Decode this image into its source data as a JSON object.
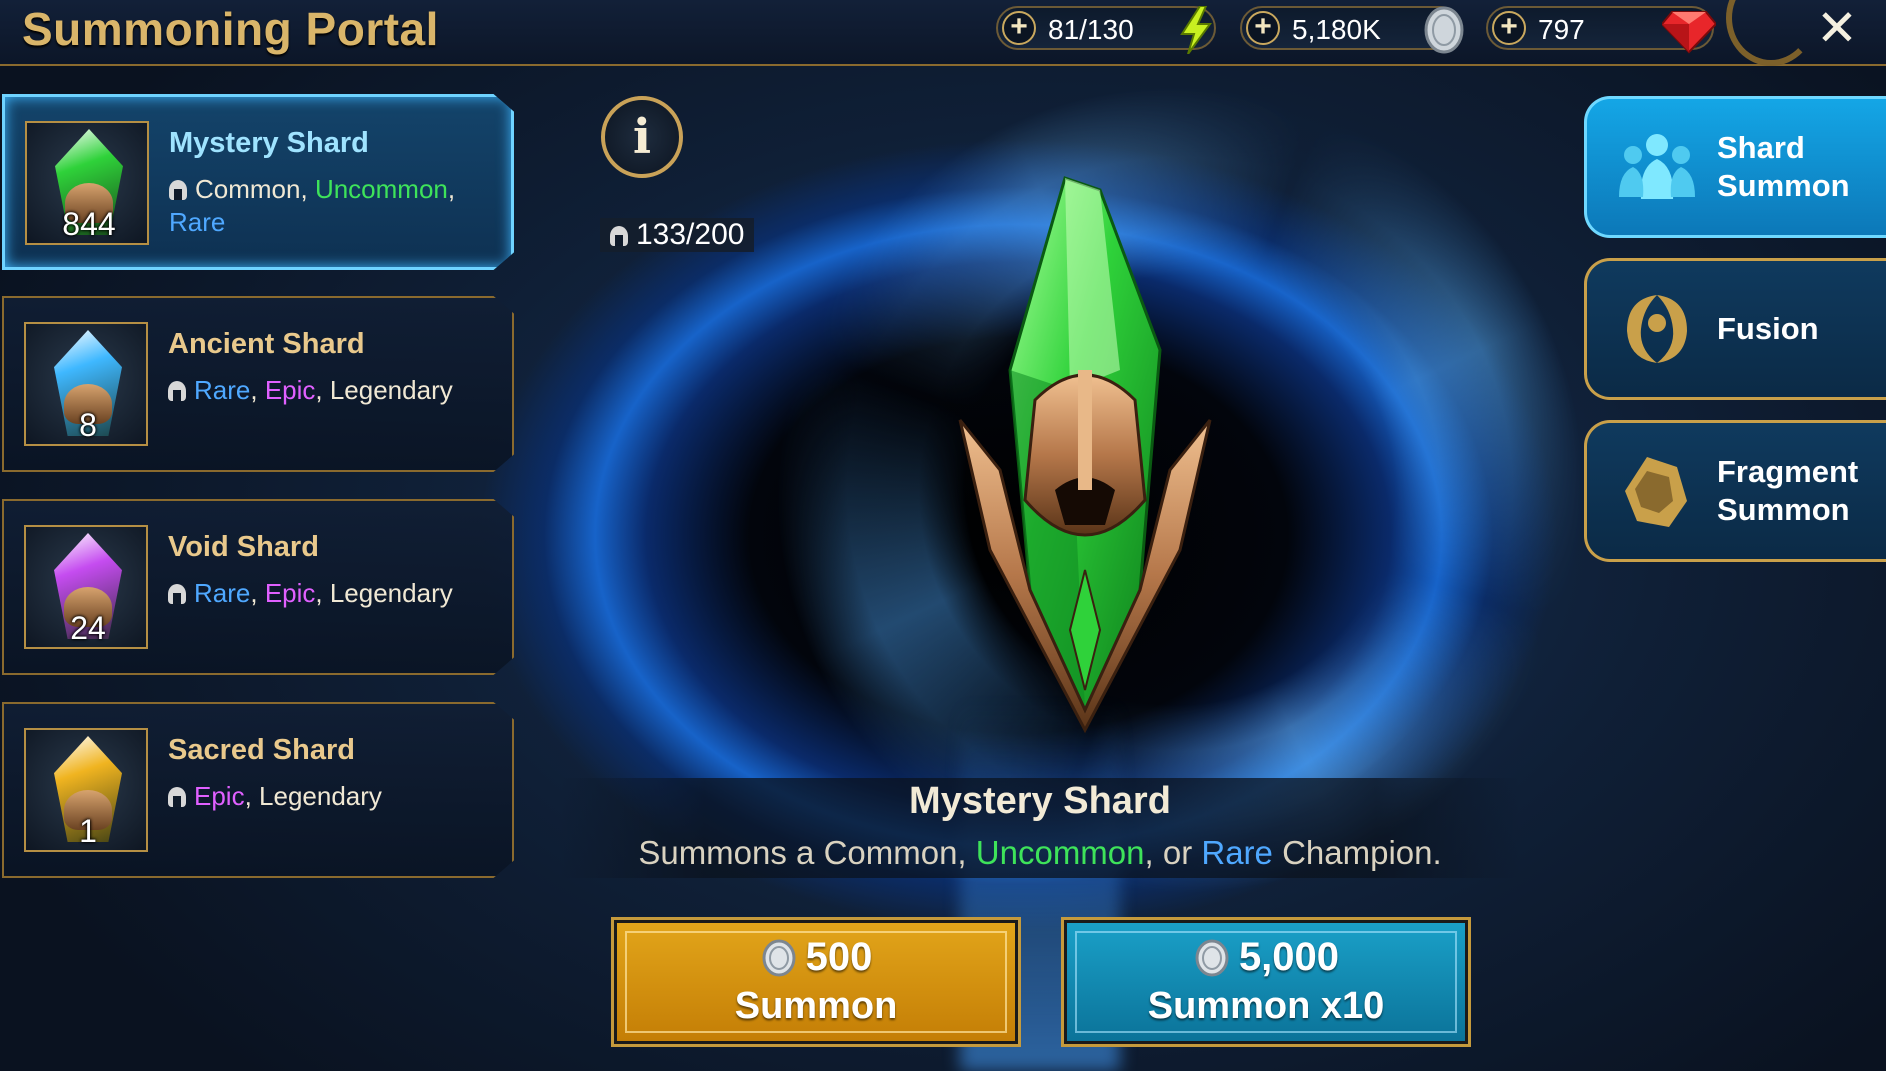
{
  "header": {
    "title": "Summoning Portal",
    "resources": [
      {
        "name": "energy",
        "value": "81/130",
        "icon": "lightning-icon"
      },
      {
        "name": "silver",
        "value": "5,180K",
        "icon": "silver-coin-icon"
      },
      {
        "name": "gems",
        "value": "797",
        "icon": "ruby-gem-icon"
      }
    ],
    "plus_symbol": "+",
    "close_symbol": "✕"
  },
  "shards": [
    {
      "name": "Mystery Shard",
      "count": "844",
      "gem_color": "#2fd23a",
      "selected": true,
      "rarities": [
        {
          "text": "Common",
          "color": "#f0e8d4"
        },
        {
          "text": "Uncommon",
          "color": "#3ee35a"
        },
        {
          "text": "Rare",
          "color": "#4fa8ff"
        }
      ]
    },
    {
      "name": "Ancient Shard",
      "count": "8",
      "gem_color": "#3fb8ff",
      "selected": false,
      "rarities": [
        {
          "text": "Rare",
          "color": "#4fa8ff"
        },
        {
          "text": "Epic",
          "color": "#e060ff"
        },
        {
          "text": "Legendary",
          "color": "#f0e8d4"
        }
      ]
    },
    {
      "name": "Void Shard",
      "count": "24",
      "gem_color": "#c54cf0",
      "selected": false,
      "rarities": [
        {
          "text": "Rare",
          "color": "#4fa8ff"
        },
        {
          "text": "Epic",
          "color": "#e060ff"
        },
        {
          "text": "Legendary",
          "color": "#f0e8d4"
        }
      ]
    },
    {
      "name": "Sacred Shard",
      "count": "1",
      "gem_color": "#f0b420",
      "selected": false,
      "rarities": [
        {
          "text": "Epic",
          "color": "#e060ff"
        },
        {
          "text": "Legendary",
          "color": "#f0e8d4"
        }
      ]
    }
  ],
  "info": {
    "symbol": "i"
  },
  "champion_counter": "133/200",
  "selected_shard": {
    "title": "Mystery Shard",
    "desc_prefix": "Summons a Common, ",
    "desc_uncommon": "Uncommon",
    "desc_mid": ", or ",
    "desc_rare": "Rare",
    "desc_suffix": " Champion."
  },
  "summon": {
    "single": {
      "cost": "500",
      "label": "Summon"
    },
    "multi": {
      "cost": "5,000",
      "label": "Summon x10"
    }
  },
  "side_menu": [
    {
      "line1": "Shard",
      "line2": "Summon",
      "active": true,
      "icon": "champions-group-icon"
    },
    {
      "line1": "Fusion",
      "line2": "",
      "active": false,
      "icon": "fusion-swirl-icon"
    },
    {
      "line1": "Fragment",
      "line2": "Summon",
      "active": false,
      "icon": "fragment-helmet-icon"
    }
  ],
  "colors": {
    "title_gold": "#d9b56a",
    "active_blue": "#14a6e6",
    "summon_gold": "#e2a51a",
    "summon_teal": "#1aa0c8"
  }
}
